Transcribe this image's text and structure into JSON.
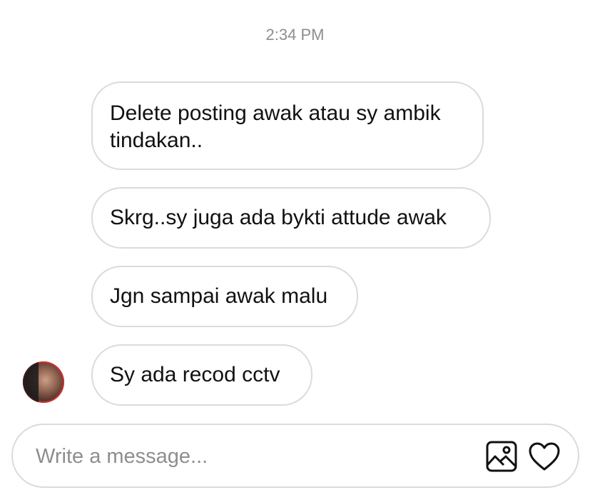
{
  "timestamp": "2:34 PM",
  "messages": [
    {
      "text": "Delete posting awak atau sy ambik tindakan.."
    },
    {
      "text": "Skrg..sy juga ada bykti attude awak"
    },
    {
      "text": "Jgn sampai awak malu"
    },
    {
      "text": "Sy ada recod cctv"
    }
  ],
  "composer": {
    "placeholder": "Write a message...",
    "value": ""
  },
  "icons": {
    "gallery": "image-gallery-icon",
    "like": "heart-icon"
  },
  "colors": {
    "bubble_border": "#dbdbdb",
    "timestamp": "#8e8e8e",
    "text": "#111111"
  }
}
